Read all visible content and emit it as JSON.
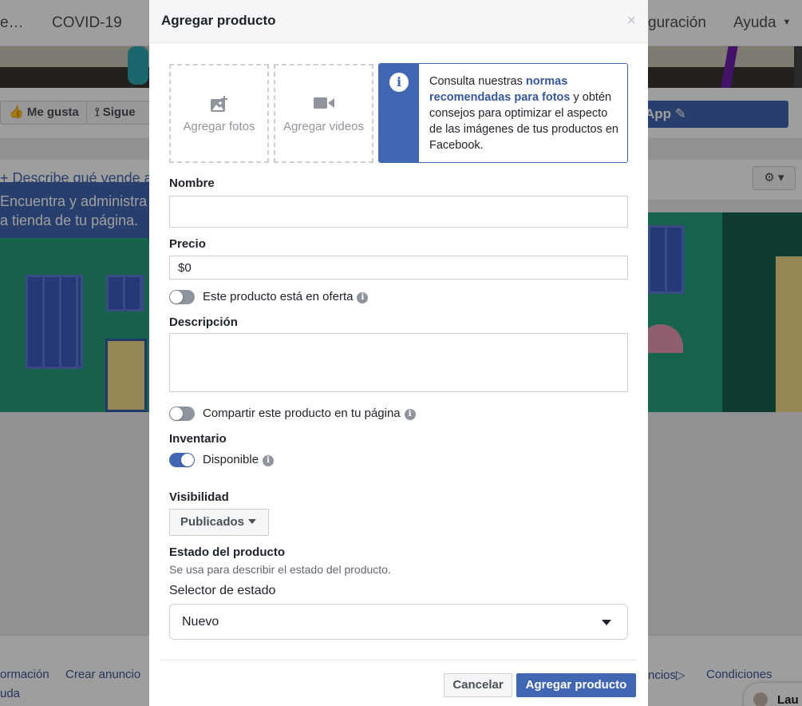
{
  "background": {
    "nav": {
      "item_cut": "e…",
      "covid": "COVID-19",
      "configuracion_partial": "guración",
      "help": "Ayuda"
    },
    "actions": {
      "like": "Me gusta",
      "follow": "Sigue",
      "app_button": "App"
    },
    "shop": {
      "describe": "+ Describe qué vende a",
      "banner_line1": "Encuentra y administra t",
      "banner_line2": "a tienda de tu página."
    },
    "footer": {
      "informacion": "ormación",
      "crear_anuncio": "Crear anuncio",
      "ayuda": "uda",
      "anuncios": "ncios",
      "condiciones": "Condiciones"
    },
    "chat_name": "Lau"
  },
  "dialog": {
    "title": "Agregar producto",
    "close": "×",
    "add_photos": "Agregar fotos",
    "add_videos": "Agregar videos",
    "info": {
      "prefix": "Consulta nuestras ",
      "link": "normas recomendadas para fotos",
      "suffix": " y obtén consejos para optimizar el aspecto de las imágenes de tus productos en Facebook."
    },
    "name_label": "Nombre",
    "name_value": "",
    "price_label": "Precio",
    "price_value": "$0",
    "on_sale": {
      "label": "Este producto está en oferta",
      "on": false
    },
    "description_label": "Descripción",
    "description_value": "",
    "share": {
      "label": "Compartir este producto en tu página",
      "on": false
    },
    "inventory_label": "Inventario",
    "available": {
      "label": "Disponible",
      "on": true
    },
    "visibility_label": "Visibilidad",
    "visibility_value": "Publicados",
    "condition_label": "Estado del producto",
    "condition_help": "Se usa para describir el estado del producto.",
    "condition_selector_label": "Selector de estado",
    "condition_value": "Nuevo",
    "cancel": "Cancelar",
    "submit": "Agregar producto"
  },
  "colors": {
    "accent": "#4267b2",
    "overlay": "rgba(0,0,0,0.38)"
  }
}
